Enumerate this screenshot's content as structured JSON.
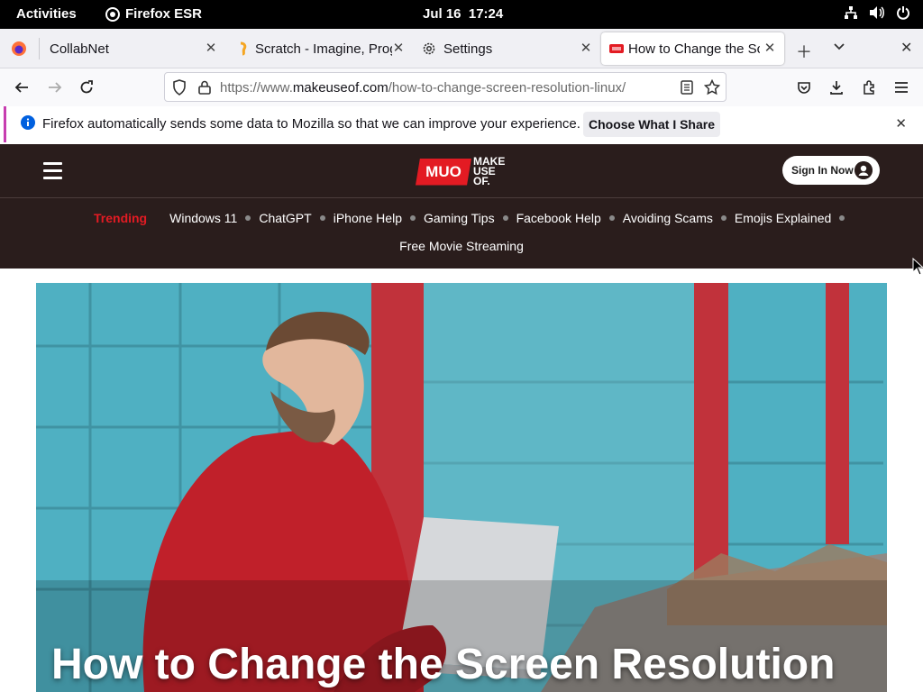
{
  "topbar": {
    "activities": "Activities",
    "app_name": "Firefox ESR",
    "date": "Jul 16",
    "time": "17:24"
  },
  "tabs": [
    {
      "title": "CollabNet",
      "icon": "firefox-icon",
      "active": false
    },
    {
      "title": "Scratch - Imagine, Prog",
      "icon": "scratch-icon",
      "active": false
    },
    {
      "title": "Settings",
      "icon": "gear-icon",
      "active": false
    },
    {
      "title": "How to Change the Scr",
      "icon": "muo-favicon",
      "active": true
    }
  ],
  "navbar": {
    "url_prefix": "https://www.",
    "url_domain": "makeuseof.com",
    "url_path": "/how-to-change-screen-resolution-linux/"
  },
  "notice": {
    "message": "Firefox automatically sends some data to Mozilla so that we can improve your experience.",
    "button": "Choose What I Share"
  },
  "site": {
    "logo_mark": "MUO",
    "logo_words": [
      "MAKE",
      "USE",
      "OF."
    ],
    "sign_in": "Sign In Now",
    "accent_color": "#e31b23",
    "header_bg": "#2a1d1c"
  },
  "trending": {
    "label": "Trending",
    "items": [
      "Windows 11",
      "ChatGPT",
      "iPhone Help",
      "Gaming Tips",
      "Facebook Help",
      "Avoiding Scams",
      "Emojis Explained"
    ],
    "second_row": "Free Movie Streaming"
  },
  "article": {
    "title": "How to Change the Screen Resolution"
  }
}
